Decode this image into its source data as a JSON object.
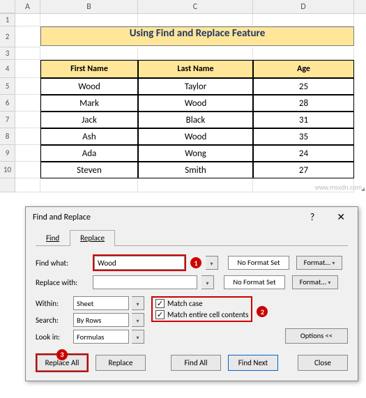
{
  "columns": [
    "A",
    "B",
    "C",
    "D"
  ],
  "rows": [
    "1",
    "2",
    "3",
    "4",
    "5",
    "6",
    "7",
    "8",
    "9",
    "10"
  ],
  "title": "Using Find and Replace Feature",
  "headers": {
    "b": "First Name",
    "c": "Last Name",
    "d": "Age"
  },
  "data": [
    {
      "b": "Wood",
      "c": "Taylor",
      "d": "25"
    },
    {
      "b": "Mark",
      "c": "Wood",
      "d": "28"
    },
    {
      "b": "Jack",
      "c": "Black",
      "d": "31"
    },
    {
      "b": "Ash",
      "c": "Wood",
      "d": "35"
    },
    {
      "b": "Ada",
      "c": "Wong",
      "d": "24"
    },
    {
      "b": "Steven",
      "c": "Smith",
      "d": "27"
    }
  ],
  "dialog": {
    "title": "Find and Replace",
    "help": "?",
    "close": "✕",
    "tabs": {
      "find": "Find",
      "replace": "Replace"
    },
    "find_what_label": "Find what:",
    "find_what_value": "Wood",
    "replace_with_label": "Replace with:",
    "replace_with_value": "",
    "no_format": "No Format Set",
    "format_btn": "Format...",
    "within_label": "Within:",
    "within_value": "Sheet",
    "search_label": "Search:",
    "search_value": "By Rows",
    "lookin_label": "Look in:",
    "lookin_value": "Formulas",
    "match_case": "Match case",
    "match_entire": "Match entire cell contents",
    "options": "Options <<",
    "replace_all": "Replace All",
    "replace": "Replace",
    "find_all": "Find All",
    "find_next": "Find Next",
    "close_btn": "Close"
  },
  "watermark": "www.msxdn.com"
}
